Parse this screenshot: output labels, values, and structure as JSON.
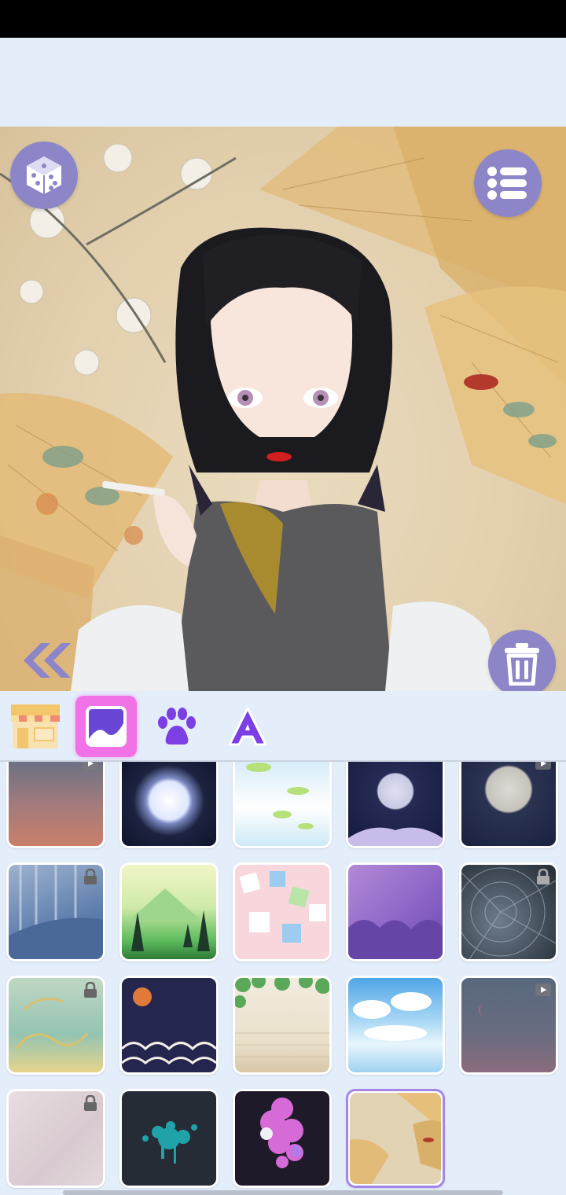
{
  "toolbar": {
    "tabs": [
      {
        "name": "shop",
        "icon": "shop-icon",
        "selected": false
      },
      {
        "name": "background",
        "icon": "background-image-icon",
        "selected": true
      },
      {
        "name": "pet",
        "icon": "paw-icon",
        "selected": false
      },
      {
        "name": "text",
        "icon": "letter-a-icon",
        "selected": false
      }
    ]
  },
  "canvas": {
    "buttons": [
      "dice-icon",
      "list-menu-icon",
      "trash-icon",
      "double-chevron-left-icon"
    ]
  },
  "backgrounds": [
    {
      "name": "dusk-sky",
      "badge": "video"
    },
    {
      "name": "full-moon",
      "badge": "none"
    },
    {
      "name": "lily-pads",
      "badge": "none"
    },
    {
      "name": "moon-night",
      "badge": "none"
    },
    {
      "name": "grey-moon",
      "badge": "video"
    },
    {
      "name": "blue-forest",
      "badge": "lock"
    },
    {
      "name": "green-mountain",
      "badge": "none"
    },
    {
      "name": "pink-dice",
      "badge": "none"
    },
    {
      "name": "purple-clouds",
      "badge": "none"
    },
    {
      "name": "spider-web",
      "badge": "lock"
    },
    {
      "name": "jade-waves",
      "badge": "lock"
    },
    {
      "name": "night-waves",
      "badge": "none"
    },
    {
      "name": "vine-wall",
      "badge": "none"
    },
    {
      "name": "sky-clouds",
      "badge": "none"
    },
    {
      "name": "crescent-dusk",
      "badge": "video"
    },
    {
      "name": "pale-pattern",
      "badge": "lock"
    },
    {
      "name": "teal-splatter",
      "badge": "none"
    },
    {
      "name": "pink-bubbles",
      "badge": "none"
    },
    {
      "name": "paper-fans",
      "badge": "none",
      "selected": true
    }
  ],
  "colors": {
    "accent": "#8c86c8",
    "tab_selected": "#f072e6",
    "selected_border": "#a486e6"
  }
}
